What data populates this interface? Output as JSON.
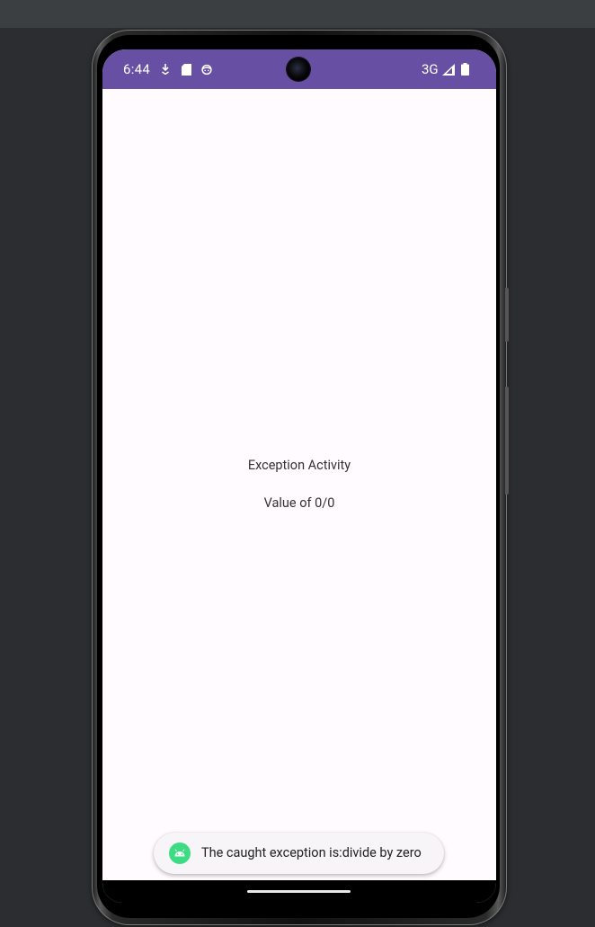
{
  "status_bar": {
    "time": "6:44",
    "notification_icons": [
      "download-arrow-icon",
      "sd-card-icon",
      "face-icon"
    ],
    "network": "3G",
    "signal_icon": "cell-signal-icon",
    "battery_icon": "battery-icon"
  },
  "main": {
    "title": "Exception Activity",
    "value_label": "Value of 0/0"
  },
  "toast": {
    "icon": "android-icon",
    "message": "The caught exception is:divide by zero"
  },
  "colors": {
    "status_bar": "#6750a4",
    "background": "#fffbfe",
    "android_green": "#3ddc84"
  }
}
